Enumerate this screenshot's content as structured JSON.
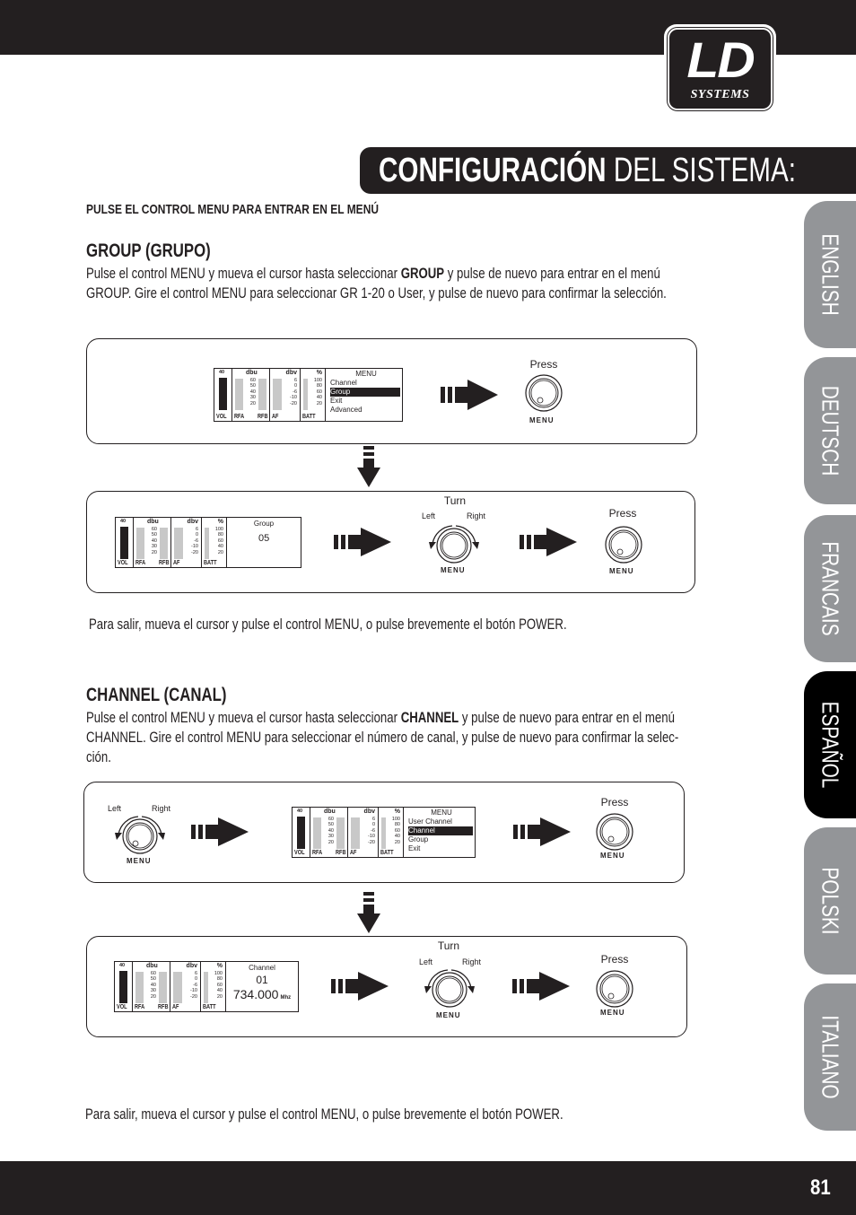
{
  "header": {
    "logo": {
      "main": "LD",
      "sub": "SYSTEMS"
    },
    "title_bold": "CONFIGURACIÓN",
    "title_light": " DEL SISTEMA:"
  },
  "instruction": "PULSE EL CONTROL MENU PARA ENTRAR EN EL MENÚ",
  "group_section": {
    "heading": "GROUP (GRUPO)",
    "para_line1_pre": "Pulse el control MENU y mueva el cursor hasta seleccionar ",
    "para_line1_bold": "GROUP",
    "para_line1_post": " y pulse de nuevo para entrar en el menú",
    "para_line2": "GROUP. Gire el control MENU para seleccionar GR 1-20 o User, y pulse de nuevo para confirmar la selección.",
    "exit_note": "Para salir, mueva el cursor y pulse el control MENU, o pulse brevemente el botón POWER."
  },
  "channel_section": {
    "heading": "CHANNEL (CANAL)",
    "para_line1_pre": "Pulse el control MENU y mueva el cursor hasta seleccionar ",
    "para_line1_bold": "CHANNEL",
    "para_line1_post": " y pulse de nuevo para entrar en el menú",
    "para_line2": "CHANNEL. Gire el control MENU para seleccionar el número de canal, y pulse de nuevo para confirmar la selec-",
    "para_line3": "ción.",
    "exit_note": "Para salir, mueva el cursor y pulse el control MENU, o pulse brevemente el botón POWER."
  },
  "lcd_common": {
    "vol_top": "40",
    "vol_label": "VOL",
    "dbu_label": "dbu",
    "dbu_values": [
      "60",
      "50",
      "40",
      "30",
      "20"
    ],
    "rfa_label": "RFA",
    "rfb_label": "RFB",
    "dbv_label": "dbv",
    "dbv_values": [
      "6",
      "0",
      "-6",
      "-10",
      "-20"
    ],
    "af_label": "AF",
    "pct_label": "%",
    "pct_values": [
      "100",
      "80",
      "60",
      "40",
      "20"
    ],
    "batt_label": "BATT"
  },
  "diagram1": {
    "menu_title": "MENU",
    "menu_items": [
      "Channel",
      "Group",
      "Exit",
      "Advanced"
    ],
    "selected": "Group",
    "press": "Press",
    "knob_label": "MENU"
  },
  "diagram2": {
    "screen_title": "Group",
    "screen_value": "05",
    "turn": "Turn",
    "left": "Left",
    "right": "Right",
    "press": "Press",
    "knob_label": "MENU"
  },
  "diagram3": {
    "left": "Left",
    "right": "Right",
    "knob_label": "MENU",
    "menu_title": "MENU",
    "menu_items": [
      "User Channel",
      "Channel",
      "Group",
      "Exit"
    ],
    "selected": "Channel",
    "press": "Press"
  },
  "diagram4": {
    "screen_title": "Channel",
    "screen_value": "01",
    "frequency": "734.000",
    "freq_unit": "Mhz",
    "turn": "Turn",
    "left": "Left",
    "right": "Right",
    "press": "Press",
    "knob_label": "MENU"
  },
  "language_tabs": [
    {
      "label": "ENGLISH",
      "active": false
    },
    {
      "label": "DEUTSCH",
      "active": false
    },
    {
      "label": "FRANCAIS",
      "active": false
    },
    {
      "label": "ESPAÑOL",
      "active": true
    },
    {
      "label": "POLSKI",
      "active": false
    },
    {
      "label": "ITALIANO",
      "active": false
    }
  ],
  "colors": {
    "dark": "#231f20",
    "tab_inactive": "#939598",
    "tab_active": "#000000",
    "lcd_bar": "#c8c8c8"
  },
  "footer": {
    "page_number": "81"
  }
}
